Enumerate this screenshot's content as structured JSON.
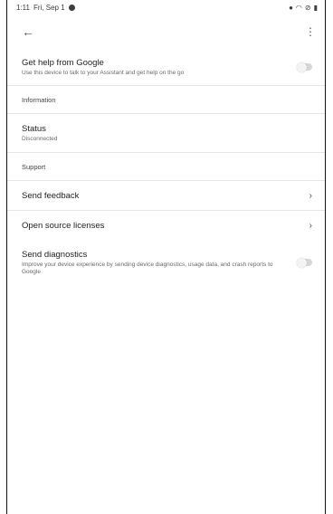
{
  "status_bar": {
    "time": "1:11",
    "date": "Fri, Sep 1"
  },
  "toolbar": {
    "back_icon": "arrow-back-icon",
    "more_icon": "more-vert-icon"
  },
  "help_item": {
    "title": "Get help from Google",
    "subtitle": "Use this device to talk to your Assistant and get help on the go"
  },
  "section_information": "Information",
  "status_item": {
    "title": "Status",
    "value": "Disconnected"
  },
  "section_support": "Support",
  "support_items": [
    {
      "label": "Send feedback"
    },
    {
      "label": "Open source licenses"
    }
  ],
  "diagnostics_item": {
    "title": "Send diagnostics",
    "subtitle": "Improve your device experience by sending device diagnostics, usage data, and crash reports to Google"
  },
  "colors": {
    "switch_off": "#d6d6d6",
    "text_primary": "#1f1f1f",
    "text_secondary": "#6a6a6a"
  }
}
